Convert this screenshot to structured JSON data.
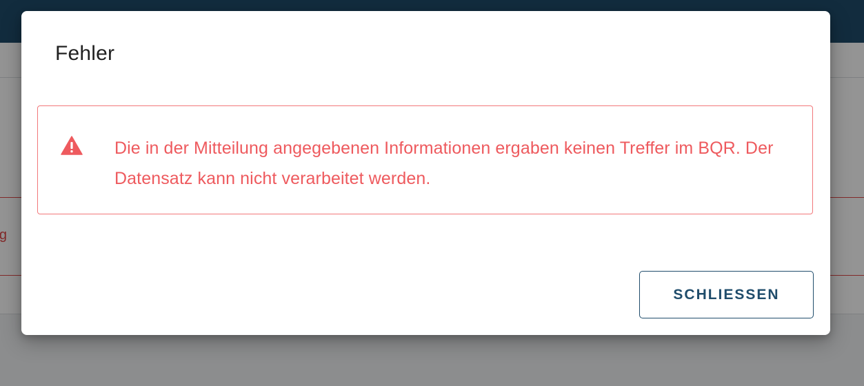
{
  "background": {
    "partial_text": "rg"
  },
  "dialog": {
    "title": "Fehler",
    "alert": {
      "icon": "warning-triangle-icon",
      "message": "Die in der Mitteilung angegebenen Informationen ergaben keinen Treffer im BQR. Der Datensatz kann nicht verarbeitet werden."
    },
    "close_label": "SCHLIESSEN"
  },
  "colors": {
    "error": "#ee5a5e",
    "alert_border": "#f2777a",
    "primary": "#1f4c6b",
    "header": "#1f4c6b"
  }
}
